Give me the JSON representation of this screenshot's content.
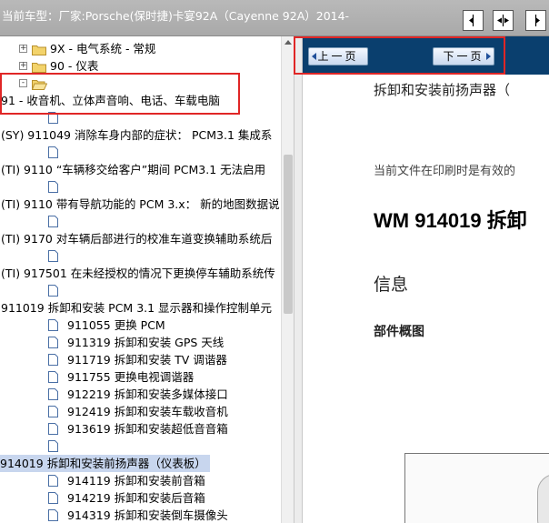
{
  "window": {
    "title": "当前车型：厂家:Porsche(保时捷)卡宴92A（Cayenne 92A）2014-"
  },
  "toolbar": {
    "icons": [
      "pane-left-icon",
      "pane-split-icon",
      "pane-right-icon"
    ]
  },
  "tree": {
    "items": [
      {
        "label": "9X - 电气系统 - 常规",
        "type": "folder",
        "expander": "+"
      },
      {
        "label": "90 - 仪表",
        "type": "folder",
        "expander": "+"
      },
      {
        "label": "",
        "type": "folder-open",
        "expander": "-"
      },
      {
        "label": "91 - 收音机、立体声音响、电话、车载电脑",
        "type": "text"
      },
      {
        "label": "",
        "type": "doc"
      },
      {
        "label": "(SY) 911049 消除车身内部的症状： PCM3.1 集成系",
        "type": "text"
      },
      {
        "label": "",
        "type": "doc"
      },
      {
        "label": "(TI) 9110 “车辆移交给客户”期间 PCM3.1 无法启用",
        "type": "text"
      },
      {
        "label": "",
        "type": "doc"
      },
      {
        "label": "(TI) 9110 带有导航功能的 PCM 3.x： 新的地图数据说",
        "type": "text"
      },
      {
        "label": "",
        "type": "doc"
      },
      {
        "label": "(TI) 9170 对车辆后部进行的校准车道变换辅助系统后",
        "type": "text"
      },
      {
        "label": "",
        "type": "doc"
      },
      {
        "label": "(TI) 917501 在未经授权的情况下更换停车辅助系统传",
        "type": "text"
      },
      {
        "label": "",
        "type": "doc"
      },
      {
        "label": "911019 拆卸和安装 PCM 3.1 显示器和操作控制单元",
        "type": "text"
      },
      {
        "label": "911055 更换 PCM",
        "type": "doc"
      },
      {
        "label": "911319 拆卸和安装 GPS 天线",
        "type": "doc"
      },
      {
        "label": "911719 拆卸和安装 TV 调谐器",
        "type": "doc"
      },
      {
        "label": "911755 更换电视调谐器",
        "type": "doc"
      },
      {
        "label": "912219 拆卸和安装多媒体接口",
        "type": "doc"
      },
      {
        "label": "912419 拆卸和安装车载收音机",
        "type": "doc"
      },
      {
        "label": "913619 拆卸和安装超低音音箱",
        "type": "doc"
      },
      {
        "label": "",
        "type": "doc"
      },
      {
        "label": "914019 拆卸和安装前扬声器（仪表板）",
        "type": "text",
        "selected": true
      },
      {
        "label": "914119 拆卸和安装前音箱",
        "type": "doc"
      },
      {
        "label": "914219 拆卸和安装后音箱",
        "type": "doc"
      },
      {
        "label": "914319 拆卸和安装倒车摄像头",
        "type": "doc"
      }
    ]
  },
  "viewer": {
    "prev_label": "上一页",
    "next_label": "下一页",
    "heading": "拆卸和安装前扬声器（",
    "print_note": "当前文件在印刷时是有效的",
    "wm_title": "WM 914019 拆卸",
    "info": "信息",
    "parts_overview": "部件概图"
  },
  "colors": {
    "highlight": "#e02626",
    "nav_bar": "#0a3f6e",
    "selection": "#c8d6ee"
  }
}
